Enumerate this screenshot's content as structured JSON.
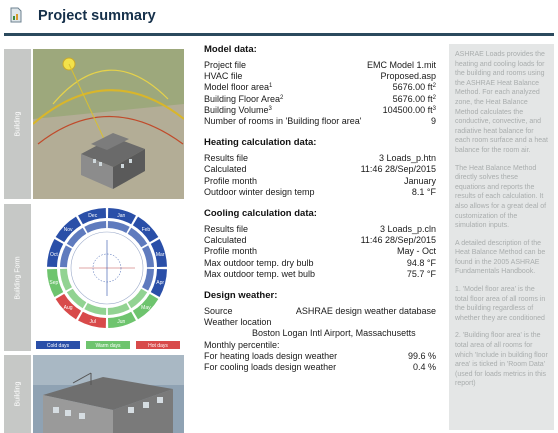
{
  "header": {
    "title": "Project summary"
  },
  "side": {
    "tab1": "Building",
    "tab2": "Building Form",
    "tab3": "Building",
    "wheel": {
      "months": [
        "Jan",
        "Feb",
        "Mar",
        "Apr",
        "May",
        "Jun",
        "Jul",
        "Aug",
        "Sep",
        "Oct",
        "Nov",
        "Dec"
      ],
      "legend": [
        "Cold days",
        "Warm days",
        "Hot days"
      ]
    }
  },
  "model": {
    "title": "Model data:",
    "rows": [
      {
        "label": "Project file",
        "sup": "",
        "value": "EMC Model 1.mit",
        "unit_sup": ""
      },
      {
        "label": "HVAC file",
        "sup": "",
        "value": "Proposed.asp",
        "unit_sup": ""
      },
      {
        "label": "Model floor area",
        "sup": "1",
        "value": "5676.00 ft",
        "unit_sup": "2"
      },
      {
        "label": "Building Floor Area",
        "sup": "2",
        "value": "5676.00 ft",
        "unit_sup": "2"
      },
      {
        "label": "Building Volume",
        "sup": "3",
        "value": "104500.00 ft",
        "unit_sup": "3"
      },
      {
        "label": "Number of rooms in 'Building floor area'",
        "sup": "",
        "value": "9",
        "unit_sup": ""
      }
    ]
  },
  "heating": {
    "title": "Heating calculation data:",
    "rows": [
      {
        "label": "Results file",
        "value": "3 Loads_p.htn"
      },
      {
        "label": "Calculated",
        "value": "11:46  28/Sep/2015"
      },
      {
        "label": "Profile month",
        "value": "January"
      },
      {
        "label": "Outdoor winter design temp",
        "value": "8.1  °F"
      }
    ]
  },
  "cooling": {
    "title": "Cooling calculation data:",
    "rows": [
      {
        "label": "Results file",
        "value": "3 Loads_p.cln"
      },
      {
        "label": "Calculated",
        "value": "11:46  28/Sep/2015"
      },
      {
        "label": "Profile month",
        "value": "May - Oct"
      },
      {
        "label": "Max outdoor temp. dry bulb",
        "value": "94.8  °F"
      },
      {
        "label": "Max outdoor temp. wet bulb",
        "value": "75.7  °F"
      }
    ]
  },
  "weather": {
    "title": "Design weather:",
    "source_label": "Source",
    "source_value": "ASHRAE design weather database",
    "location_label": "Weather location",
    "location_value": "Boston Logan Intl Airport, Massachusetts",
    "percentile_label": "Monthly percentile:",
    "rows": [
      {
        "label": "For heating loads design weather",
        "value": "99.6  %"
      },
      {
        "label": "For cooling loads design weather",
        "value": "0.4  %"
      }
    ]
  },
  "note": {
    "p1": "ASHRAE Loads provides the heating and cooling loads for the building and rooms using the ASHRAE Heat Balance Method. For each analyzed zone, the Heat Balance Method calculates the conductive, convective, and radiative heat balance for each room surface and a heat balance for the room air.",
    "p2": "The Heat Balance Method directly solves these equations and reports the results of each calculation. It also allows for a great deal of customization of the simulation inputs.",
    "p3": "A detailed description of the Heat Balance Method can be found in the 2005 ASHRAE Fundamentals Handbook.",
    "p4": "1. 'Model floor area' is the total floor area of all rooms in the building regardless of whether they are conditioned",
    "p5": "2. 'Building floor area' is the total area of all rooms for which 'Include in building floor area' is ticked in 'Room Data' (used for loads metrics in this report)"
  },
  "colors": {
    "header_rule": "#2b4a5e",
    "title": "#15304a",
    "cold": "#2a4fa8",
    "warm": "#6ec46e",
    "hot": "#d84a4a"
  }
}
